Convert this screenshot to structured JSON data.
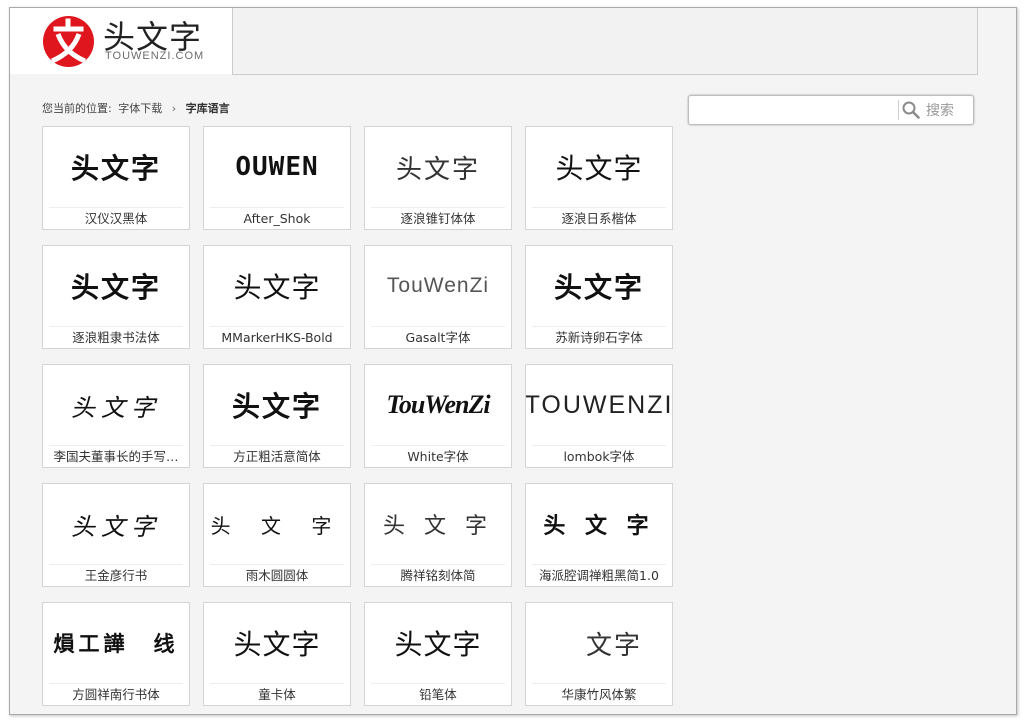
{
  "header": {
    "logo_glyph": "文",
    "logo_title": "头文字",
    "logo_domain": "TOUWENZI.COM"
  },
  "breadcrumb": {
    "prefix": "您当前的位置:",
    "parent": "字体下载",
    "separator": "›",
    "current": "字库语言"
  },
  "search": {
    "value": "",
    "button_label": "搜索"
  },
  "fonts": [
    {
      "preview": "头文字",
      "name": "汉仪汉黑体"
    },
    {
      "preview": "OUWEN",
      "name": "After_Shok"
    },
    {
      "preview": "头文字",
      "name": "逐浪锥钉体体"
    },
    {
      "preview": "头文字",
      "name": "逐浪日系楷体"
    },
    {
      "preview": "头文字",
      "name": "逐浪粗隶书法体"
    },
    {
      "preview": "头文字",
      "name": "MMarkerHKS-Bold"
    },
    {
      "preview": "TouWenZi",
      "name": "Gasalt字体"
    },
    {
      "preview": "头文字",
      "name": "苏新诗卵石字体"
    },
    {
      "preview": "头文字",
      "name": "李国夫董事长的手写…"
    },
    {
      "preview": "头文字",
      "name": "方正粗活意简体"
    },
    {
      "preview": "TouWenZi",
      "name": "White字体"
    },
    {
      "preview": "TOUWENZI",
      "name": "lombok字体"
    },
    {
      "preview": "头文字",
      "name": "王金彦行书"
    },
    {
      "preview": "头 文 字",
      "name": "雨木圆圆体"
    },
    {
      "preview": "头 文 字",
      "name": "腾祥铭刻体简"
    },
    {
      "preview": "头 文 字",
      "name": "海派腔调禅粗黑简1.0"
    },
    {
      "preview": "熉工譁　线",
      "name": "方圆祥南行书体"
    },
    {
      "preview": "头文字",
      "name": "童卡体"
    },
    {
      "preview": "头文字",
      "name": "铅笔体"
    },
    {
      "preview": "文字",
      "name": "华康竹风体繁"
    }
  ],
  "colors": {
    "brand_red": "#e0161e",
    "background": "#f4f4f4",
    "card_border": "#d4d4d4"
  }
}
